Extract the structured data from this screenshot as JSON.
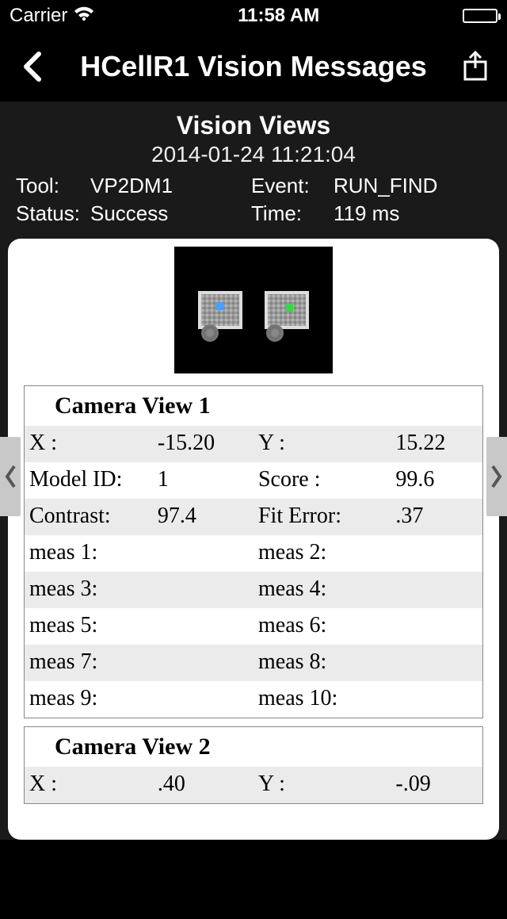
{
  "status_bar": {
    "carrier": "Carrier",
    "time": "11:58 AM"
  },
  "nav": {
    "title": "HCellR1 Vision Messages"
  },
  "header": {
    "title": "Vision Views",
    "timestamp": "2014-01-24 11:21:04",
    "tool_label": "Tool:",
    "tool_value": "VP2DM1",
    "event_label": "Event:",
    "event_value": "RUN_FIND",
    "status_label": "Status:",
    "status_value": "Success",
    "time_label": "Time:",
    "time_value": "119 ms"
  },
  "views": [
    {
      "title": "Camera View 1",
      "rows": [
        {
          "l1": "X :",
          "v1": "-15.20",
          "l2": "Y :",
          "v2": "15.22",
          "shaded": true
        },
        {
          "l1": "Model ID:",
          "v1": "1",
          "l2": "Score :",
          "v2": "99.6",
          "shaded": false
        },
        {
          "l1": "Contrast:",
          "v1": "97.4",
          "l2": "Fit Error:",
          "v2": ".37",
          "shaded": true
        },
        {
          "l1": "meas 1:",
          "v1": "",
          "l2": "meas 2:",
          "v2": "",
          "shaded": false
        },
        {
          "l1": "meas 3:",
          "v1": "",
          "l2": "meas 4:",
          "v2": "",
          "shaded": true
        },
        {
          "l1": "meas 5:",
          "v1": "",
          "l2": "meas 6:",
          "v2": "",
          "shaded": false
        },
        {
          "l1": "meas 7:",
          "v1": "",
          "l2": "meas 8:",
          "v2": "",
          "shaded": true
        },
        {
          "l1": "meas 9:",
          "v1": "",
          "l2": "meas 10:",
          "v2": "",
          "shaded": false
        }
      ]
    },
    {
      "title": "Camera View 2",
      "rows": [
        {
          "l1": "X :",
          "v1": ".40",
          "l2": "Y :",
          "v2": "-.09",
          "shaded": true
        }
      ]
    }
  ]
}
